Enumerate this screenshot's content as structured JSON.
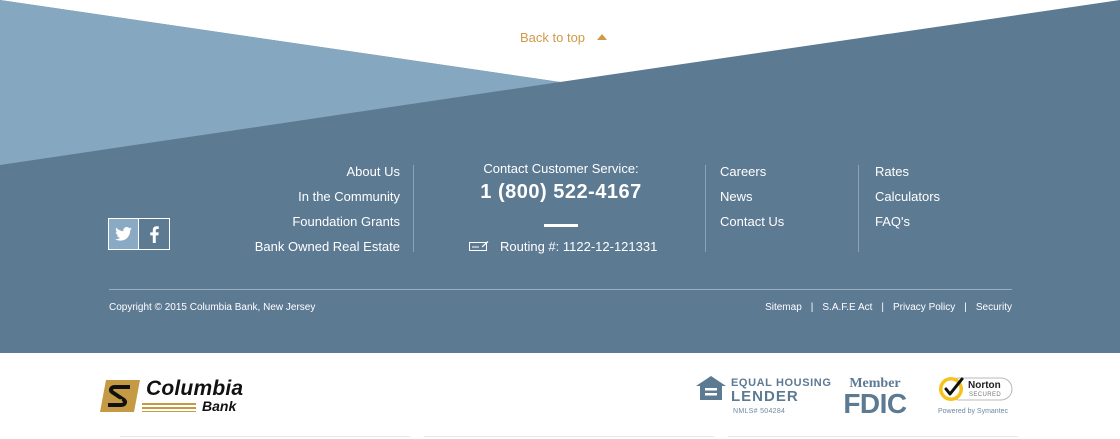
{
  "colors": {
    "band_dark": "#5d7a93",
    "band_light": "#86a7c0",
    "accent": "#cf9a48",
    "text_light": "#ffffff",
    "logo_gold": "#c49a45"
  },
  "back_to_top": {
    "label": "Back to top",
    "icon": "caret-up-icon"
  },
  "social": [
    {
      "name": "twitter",
      "icon": "twitter-icon"
    },
    {
      "name": "facebook",
      "icon": "facebook-icon"
    }
  ],
  "nav_left": [
    "About Us",
    "In the Community",
    "Foundation Grants",
    "Bank Owned Real Estate"
  ],
  "contact": {
    "label": "Contact Customer Service:",
    "phone": "1 (800) 522-4167",
    "routing": "Routing #: 1122-12-121331",
    "routing_icon": "check-icon"
  },
  "nav_mid": [
    "Careers",
    "News",
    "Contact Us"
  ],
  "nav_right": [
    "Rates",
    "Calculators",
    "FAQ's"
  ],
  "copyright": "Copyright © 2015 Columbia Bank, New Jersey",
  "legal_links": [
    "Sitemap",
    "S.A.F.E Act",
    "Privacy Policy",
    "Security"
  ],
  "legal_separator": "|",
  "logo": {
    "name": "Columbia",
    "sub": "Bank"
  },
  "badges": {
    "equal_housing": {
      "line1": "EQUAL HOUSING",
      "line2": "LENDER",
      "nmls": "NMLS# 504284"
    },
    "fdic": {
      "line1": "Member",
      "line2": "FDIC"
    },
    "norton": {
      "line1": "Norton",
      "line2": "SECURED",
      "powered": "Powered by Symantec"
    }
  }
}
